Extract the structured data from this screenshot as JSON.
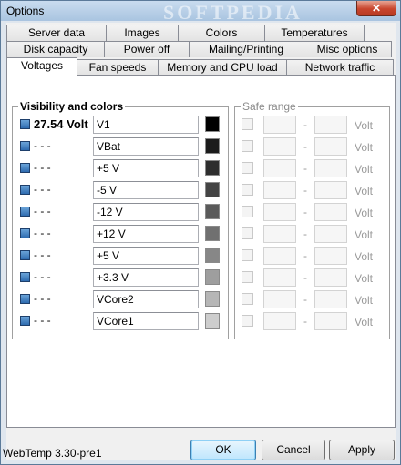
{
  "window": {
    "title": "Options",
    "close_glyph": "✕",
    "watermark": "SOFTPEDIA"
  },
  "tabs": {
    "row1": [
      "Server data",
      "Images",
      "Colors",
      "Temperatures"
    ],
    "row2": [
      "Disk capacity",
      "Power off",
      "Mailing/Printing",
      "Misc options"
    ],
    "row3": [
      "Voltages",
      "Fan speeds",
      "Memory and CPU load",
      "Network traffic"
    ],
    "active": "Voltages"
  },
  "visibility": {
    "title": "Visibility and colors",
    "rows": [
      {
        "value": "27.54 Volt",
        "name": "V1",
        "color": "#000000"
      },
      {
        "value": "- - -",
        "name": "VBat",
        "color": "#1b1b1b"
      },
      {
        "value": "- - -",
        "name": "+5 V",
        "color": "#2e2e2e"
      },
      {
        "value": "- - -",
        "name": "-5 V",
        "color": "#444444"
      },
      {
        "value": "- - -",
        "name": "-12 V",
        "color": "#5a5a5a"
      },
      {
        "value": "- - -",
        "name": "+12 V",
        "color": "#707070"
      },
      {
        "value": "- - -",
        "name": "+5 V",
        "color": "#878787"
      },
      {
        "value": "- - -",
        "name": "+3.3 V",
        "color": "#9e9e9e"
      },
      {
        "value": "- - -",
        "name": "VCore2",
        "color": "#b6b6b6"
      },
      {
        "value": "- - -",
        "name": "VCore1",
        "color": "#cdcdcd"
      }
    ]
  },
  "safe_range": {
    "title": "Safe range",
    "separator": "-",
    "unit": "Volt",
    "row_count": 10
  },
  "footer": {
    "status": "WebTemp 3.30-pre1",
    "ok": "OK",
    "cancel": "Cancel",
    "apply": "Apply"
  }
}
